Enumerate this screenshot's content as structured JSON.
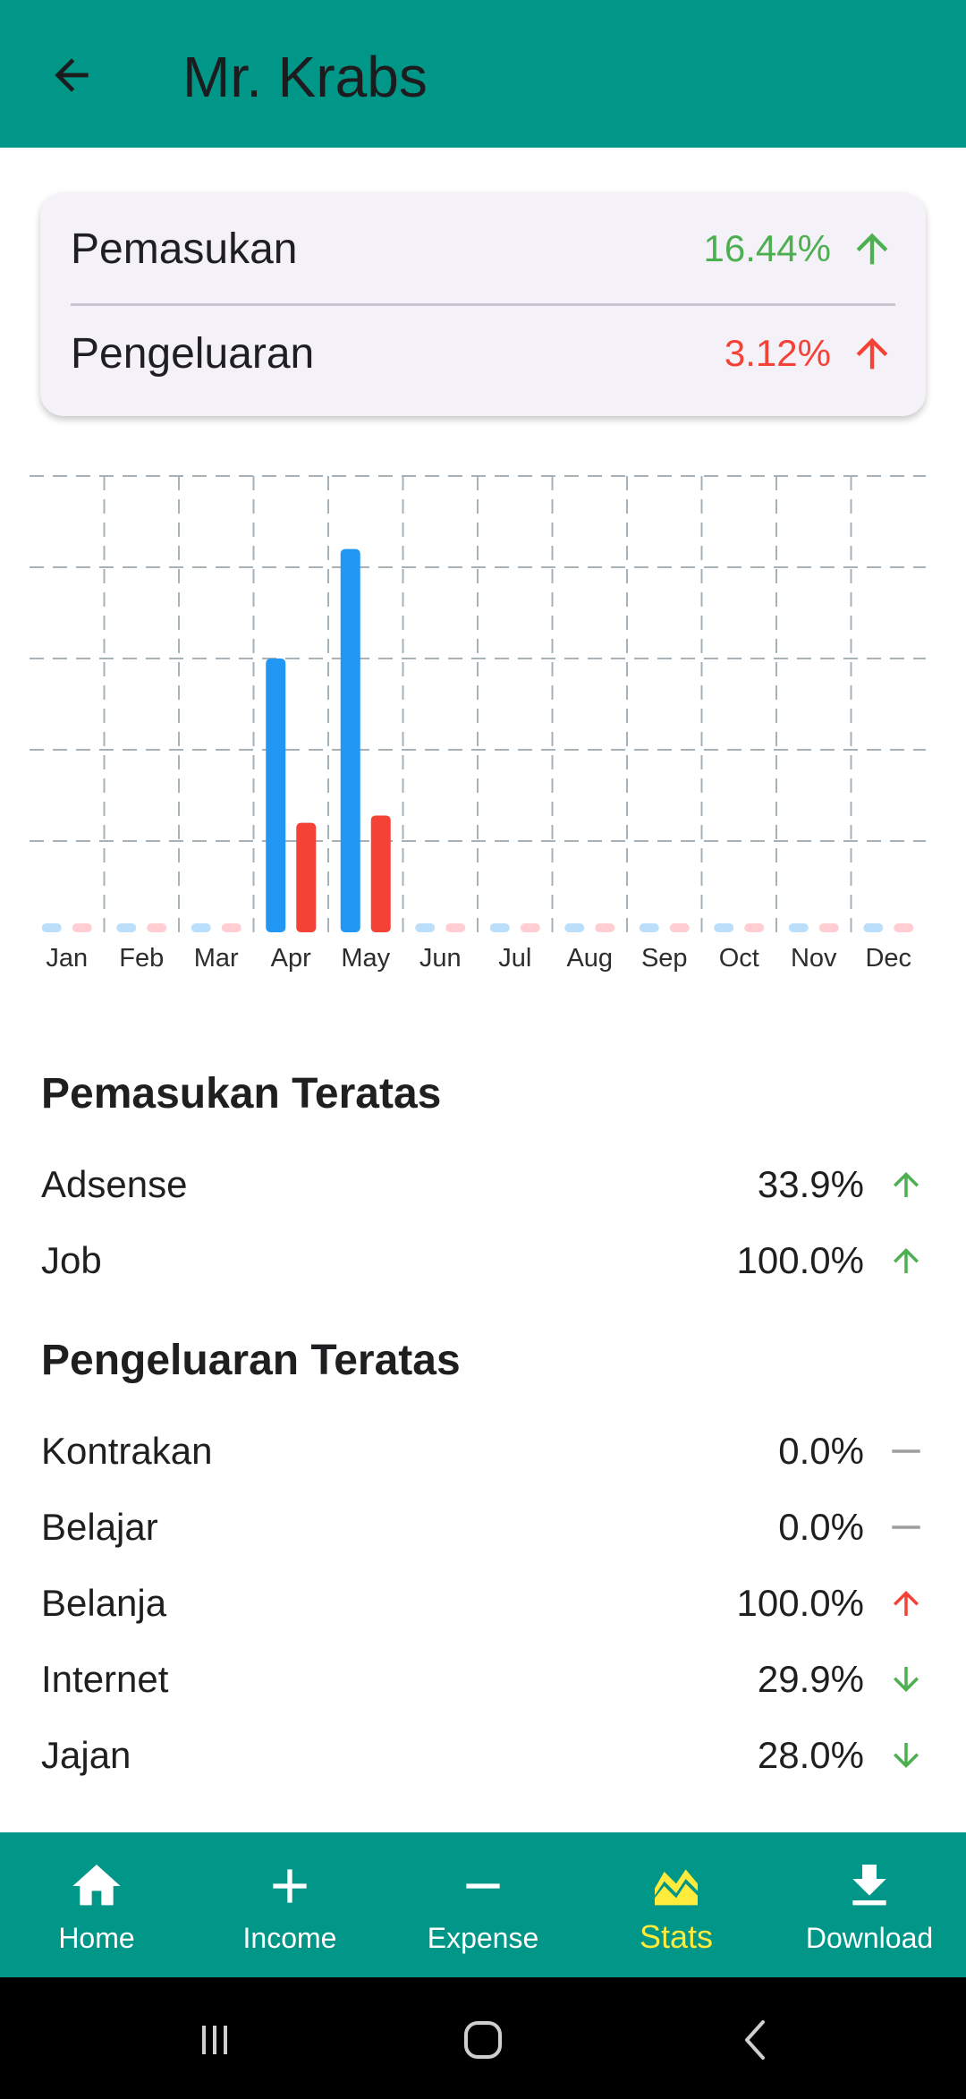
{
  "appbar": {
    "title": "Mr. Krabs",
    "back_icon": "arrow-left-icon"
  },
  "summary": {
    "income": {
      "label": "Pemasukan",
      "value": "16.44%",
      "trend": "up",
      "color": "#4caf50"
    },
    "expense": {
      "label": "Pengeluaran",
      "value": "3.12%",
      "trend": "up",
      "color": "#f44336"
    }
  },
  "chart_data": {
    "type": "bar",
    "categories": [
      "Jan",
      "Feb",
      "Mar",
      "Apr",
      "May",
      "Jun",
      "Jul",
      "Aug",
      "Sep",
      "Oct",
      "Nov",
      "Dec"
    ],
    "ylim": [
      0,
      5
    ],
    "grid": true,
    "series": [
      {
        "color": "#2196f3",
        "empty_color": "#bbdefb",
        "values": [
          0,
          0,
          0,
          3.0,
          4.2,
          0,
          0,
          0,
          0,
          0,
          0,
          0
        ]
      },
      {
        "color": "#f44336",
        "empty_color": "#ffcdd2",
        "values": [
          0,
          0,
          0,
          1.2,
          1.28,
          0,
          0,
          0,
          0,
          0,
          0,
          0
        ]
      }
    ]
  },
  "top_income": {
    "title": "Pemasukan Teratas",
    "items": [
      {
        "label": "Adsense",
        "value": "33.9%",
        "trend": "up",
        "color": "#4caf50"
      },
      {
        "label": "Job",
        "value": "100.0%",
        "trend": "up",
        "color": "#4caf50"
      }
    ]
  },
  "top_expense": {
    "title": "Pengeluaran Teratas",
    "items": [
      {
        "label": "Kontrakan",
        "value": "0.0%",
        "trend": "flat",
        "color": "#9e9e9e"
      },
      {
        "label": "Belajar",
        "value": "0.0%",
        "trend": "flat",
        "color": "#9e9e9e"
      },
      {
        "label": "Belanja",
        "value": "100.0%",
        "trend": "up",
        "color": "#f44336"
      },
      {
        "label": "Internet",
        "value": "29.9%",
        "trend": "down",
        "color": "#4caf50"
      },
      {
        "label": "Jajan",
        "value": "28.0%",
        "trend": "down",
        "color": "#4caf50"
      }
    ]
  },
  "bottom_nav": {
    "items": [
      {
        "label": "Home",
        "icon": "home-icon"
      },
      {
        "label": "Income",
        "icon": "plus-icon"
      },
      {
        "label": "Expense",
        "icon": "minus-icon"
      },
      {
        "label": "Stats",
        "icon": "stats-icon",
        "active": true
      },
      {
        "label": "Download",
        "icon": "download-icon"
      }
    ],
    "active_color": "#ffeb3b"
  },
  "system_nav": {
    "icons": [
      "recent-apps-icon",
      "home-circle-icon",
      "back-chevron-icon"
    ]
  }
}
